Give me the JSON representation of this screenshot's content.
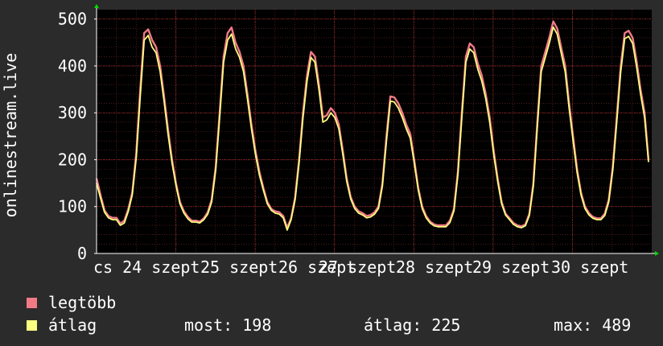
{
  "chart_data": {
    "type": "line",
    "ylabel": "onlinestream.live",
    "ylim": [
      0,
      520
    ],
    "yticks": [
      0,
      100,
      200,
      300,
      400,
      500
    ],
    "grid": true,
    "x_tick_labels": [
      "cs 24 szept",
      "25 szept",
      "26 szept",
      "27 szept",
      "28 szept",
      "29 szept",
      "30 szept"
    ],
    "series": [
      {
        "name": "legtöbb",
        "color": "#f07a86",
        "values": [
          160,
          125,
          92,
          80,
          76,
          76,
          64,
          70,
          95,
          130,
          215,
          350,
          470,
          478,
          455,
          440,
          400,
          335,
          265,
          200,
          150,
          110,
          90,
          78,
          70,
          70,
          68,
          75,
          88,
          115,
          185,
          300,
          420,
          470,
          482,
          450,
          430,
          400,
          340,
          275,
          220,
          175,
          140,
          110,
          95,
          90,
          88,
          80,
          55,
          75,
          120,
          200,
          300,
          380,
          430,
          420,
          360,
          290,
          295,
          310,
          300,
          275,
          220,
          160,
          120,
          100,
          90,
          86,
          80,
          82,
          88,
          100,
          150,
          250,
          335,
          333,
          320,
          300,
          275,
          255,
          200,
          140,
          100,
          80,
          68,
          62,
          60,
          60,
          60,
          70,
          95,
          175,
          300,
          420,
          448,
          440,
          405,
          380,
          340,
          290,
          220,
          160,
          110,
          85,
          75,
          65,
          60,
          58,
          62,
          85,
          150,
          280,
          400,
          430,
          460,
          495,
          480,
          440,
          400,
          320,
          250,
          180,
          130,
          100,
          86,
          78,
          75,
          75,
          85,
          115,
          185,
          290,
          400,
          470,
          475,
          460,
          410,
          350,
          300,
          200
        ],
        "value_range": [
          0,
          500
        ]
      },
      {
        "name": "átlag",
        "color": "#fbfc80",
        "values": [
          150,
          118,
          88,
          76,
          72,
          72,
          60,
          65,
          90,
          125,
          205,
          335,
          455,
          465,
          440,
          428,
          388,
          325,
          255,
          193,
          145,
          106,
          86,
          74,
          67,
          67,
          65,
          72,
          84,
          110,
          178,
          290,
          408,
          455,
          468,
          437,
          418,
          388,
          330,
          266,
          212,
          168,
          135,
          106,
          92,
          86,
          84,
          76,
          50,
          72,
          115,
          193,
          290,
          368,
          418,
          408,
          350,
          280,
          285,
          300,
          290,
          266,
          212,
          154,
          116,
          96,
          86,
          82,
          76,
          78,
          84,
          96,
          144,
          240,
          325,
          323,
          310,
          290,
          266,
          246,
          193,
          135,
          96,
          76,
          65,
          59,
          57,
          57,
          57,
          66,
          91,
          168,
          290,
          408,
          436,
          428,
          393,
          368,
          330,
          280,
          212,
          154,
          106,
          82,
          72,
          62,
          57,
          55,
          59,
          81,
          144,
          270,
          388,
          418,
          448,
          483,
          468,
          428,
          388,
          310,
          241,
          173,
          125,
          96,
          82,
          75,
          72,
          72,
          81,
          110,
          178,
          280,
          388,
          458,
          463,
          448,
          398,
          340,
          290,
          195
        ],
        "value_range": [
          0,
          500
        ]
      }
    ]
  },
  "legend": {
    "items": [
      {
        "label": "legtöbb",
        "color": "#f07a86"
      },
      {
        "label": "átlag",
        "color": "#fbfc80"
      }
    ],
    "stats": {
      "now_label": "most: 198",
      "avg_label": "átlag: 225",
      "max_label": "max: 489"
    }
  },
  "colors": {
    "background": "#2b2b2b",
    "plot_background": "#000000",
    "grid": "#7a2a2a",
    "axis": "#ffffff",
    "arrow": "#00dd00"
  }
}
